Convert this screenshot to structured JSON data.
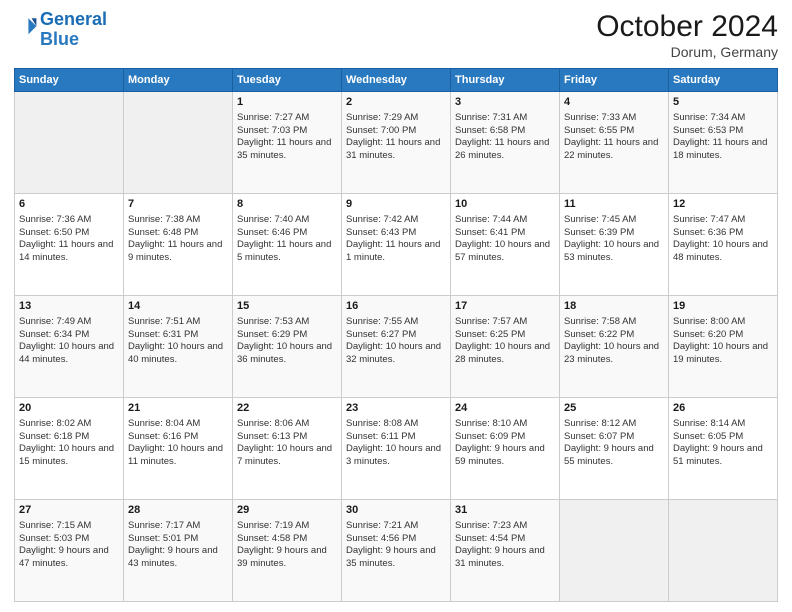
{
  "header": {
    "logo_line1": "General",
    "logo_line2": "Blue",
    "month": "October 2024",
    "location": "Dorum, Germany"
  },
  "days_of_week": [
    "Sunday",
    "Monday",
    "Tuesday",
    "Wednesday",
    "Thursday",
    "Friday",
    "Saturday"
  ],
  "weeks": [
    [
      {
        "day": "",
        "info": ""
      },
      {
        "day": "",
        "info": ""
      },
      {
        "day": "1",
        "info": "Sunrise: 7:27 AM\nSunset: 7:03 PM\nDaylight: 11 hours and 35 minutes."
      },
      {
        "day": "2",
        "info": "Sunrise: 7:29 AM\nSunset: 7:00 PM\nDaylight: 11 hours and 31 minutes."
      },
      {
        "day": "3",
        "info": "Sunrise: 7:31 AM\nSunset: 6:58 PM\nDaylight: 11 hours and 26 minutes."
      },
      {
        "day": "4",
        "info": "Sunrise: 7:33 AM\nSunset: 6:55 PM\nDaylight: 11 hours and 22 minutes."
      },
      {
        "day": "5",
        "info": "Sunrise: 7:34 AM\nSunset: 6:53 PM\nDaylight: 11 hours and 18 minutes."
      }
    ],
    [
      {
        "day": "6",
        "info": "Sunrise: 7:36 AM\nSunset: 6:50 PM\nDaylight: 11 hours and 14 minutes."
      },
      {
        "day": "7",
        "info": "Sunrise: 7:38 AM\nSunset: 6:48 PM\nDaylight: 11 hours and 9 minutes."
      },
      {
        "day": "8",
        "info": "Sunrise: 7:40 AM\nSunset: 6:46 PM\nDaylight: 11 hours and 5 minutes."
      },
      {
        "day": "9",
        "info": "Sunrise: 7:42 AM\nSunset: 6:43 PM\nDaylight: 11 hours and 1 minute."
      },
      {
        "day": "10",
        "info": "Sunrise: 7:44 AM\nSunset: 6:41 PM\nDaylight: 10 hours and 57 minutes."
      },
      {
        "day": "11",
        "info": "Sunrise: 7:45 AM\nSunset: 6:39 PM\nDaylight: 10 hours and 53 minutes."
      },
      {
        "day": "12",
        "info": "Sunrise: 7:47 AM\nSunset: 6:36 PM\nDaylight: 10 hours and 48 minutes."
      }
    ],
    [
      {
        "day": "13",
        "info": "Sunrise: 7:49 AM\nSunset: 6:34 PM\nDaylight: 10 hours and 44 minutes."
      },
      {
        "day": "14",
        "info": "Sunrise: 7:51 AM\nSunset: 6:31 PM\nDaylight: 10 hours and 40 minutes."
      },
      {
        "day": "15",
        "info": "Sunrise: 7:53 AM\nSunset: 6:29 PM\nDaylight: 10 hours and 36 minutes."
      },
      {
        "day": "16",
        "info": "Sunrise: 7:55 AM\nSunset: 6:27 PM\nDaylight: 10 hours and 32 minutes."
      },
      {
        "day": "17",
        "info": "Sunrise: 7:57 AM\nSunset: 6:25 PM\nDaylight: 10 hours and 28 minutes."
      },
      {
        "day": "18",
        "info": "Sunrise: 7:58 AM\nSunset: 6:22 PM\nDaylight: 10 hours and 23 minutes."
      },
      {
        "day": "19",
        "info": "Sunrise: 8:00 AM\nSunset: 6:20 PM\nDaylight: 10 hours and 19 minutes."
      }
    ],
    [
      {
        "day": "20",
        "info": "Sunrise: 8:02 AM\nSunset: 6:18 PM\nDaylight: 10 hours and 15 minutes."
      },
      {
        "day": "21",
        "info": "Sunrise: 8:04 AM\nSunset: 6:16 PM\nDaylight: 10 hours and 11 minutes."
      },
      {
        "day": "22",
        "info": "Sunrise: 8:06 AM\nSunset: 6:13 PM\nDaylight: 10 hours and 7 minutes."
      },
      {
        "day": "23",
        "info": "Sunrise: 8:08 AM\nSunset: 6:11 PM\nDaylight: 10 hours and 3 minutes."
      },
      {
        "day": "24",
        "info": "Sunrise: 8:10 AM\nSunset: 6:09 PM\nDaylight: 9 hours and 59 minutes."
      },
      {
        "day": "25",
        "info": "Sunrise: 8:12 AM\nSunset: 6:07 PM\nDaylight: 9 hours and 55 minutes."
      },
      {
        "day": "26",
        "info": "Sunrise: 8:14 AM\nSunset: 6:05 PM\nDaylight: 9 hours and 51 minutes."
      }
    ],
    [
      {
        "day": "27",
        "info": "Sunrise: 7:15 AM\nSunset: 5:03 PM\nDaylight: 9 hours and 47 minutes."
      },
      {
        "day": "28",
        "info": "Sunrise: 7:17 AM\nSunset: 5:01 PM\nDaylight: 9 hours and 43 minutes."
      },
      {
        "day": "29",
        "info": "Sunrise: 7:19 AM\nSunset: 4:58 PM\nDaylight: 9 hours and 39 minutes."
      },
      {
        "day": "30",
        "info": "Sunrise: 7:21 AM\nSunset: 4:56 PM\nDaylight: 9 hours and 35 minutes."
      },
      {
        "day": "31",
        "info": "Sunrise: 7:23 AM\nSunset: 4:54 PM\nDaylight: 9 hours and 31 minutes."
      },
      {
        "day": "",
        "info": ""
      },
      {
        "day": "",
        "info": ""
      }
    ]
  ]
}
